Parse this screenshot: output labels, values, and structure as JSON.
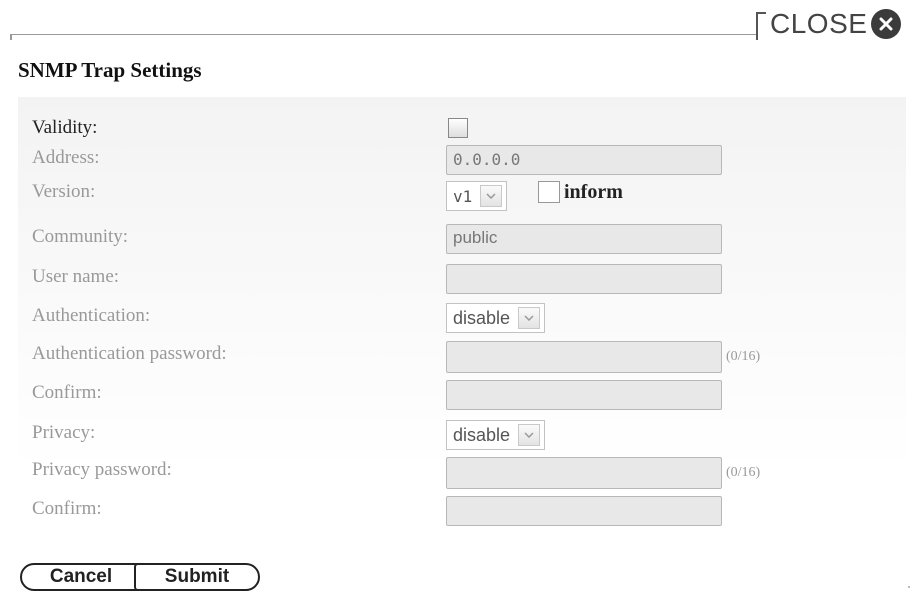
{
  "header": {
    "close_label": "CLOSE",
    "close_icon": "close-circle-icon"
  },
  "page_title": "SNMP Trap Settings",
  "form": {
    "validity": {
      "label": "Validity:",
      "checked": false
    },
    "address": {
      "label": "Address:",
      "value": "0.0.0.0"
    },
    "version": {
      "label": "Version:",
      "selected": "v1",
      "inform_label": "inform",
      "inform_checked": false
    },
    "community": {
      "label": "Community:",
      "value": "public"
    },
    "user_name": {
      "label": "User name:",
      "value": ""
    },
    "authentication": {
      "label": "Authentication:",
      "selected": "disable"
    },
    "auth_password": {
      "label": "Authentication password:",
      "value": "",
      "counter": "(0/16)"
    },
    "auth_confirm": {
      "label": "Confirm:",
      "value": ""
    },
    "privacy": {
      "label": "Privacy:",
      "selected": "disable"
    },
    "privacy_password": {
      "label": "Privacy password:",
      "value": "",
      "counter": "(0/16)"
    },
    "privacy_confirm": {
      "label": "Confirm:",
      "value": ""
    }
  },
  "buttons": {
    "cancel_label": "Cancel",
    "submit_label": "Submit"
  },
  "colors": {
    "disabled_text": "#999999",
    "field_bg": "#e8e8e8",
    "close_icon_bg": "#3b3b3b"
  }
}
